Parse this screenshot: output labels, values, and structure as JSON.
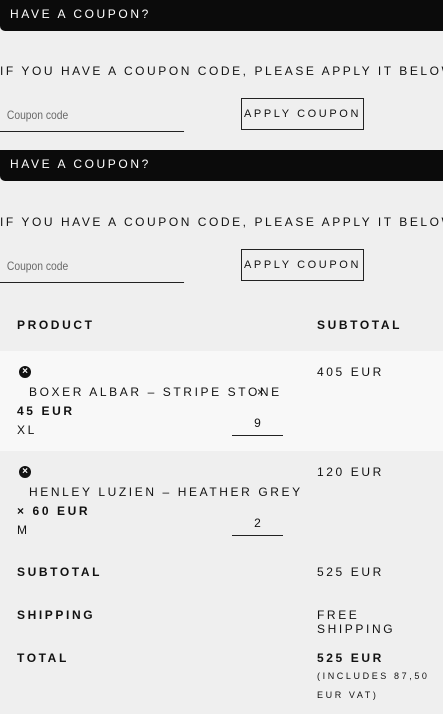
{
  "coupon_sections": [
    {
      "title": "HAVE A COUPON?",
      "info": "IF YOU HAVE A COUPON CODE, PLEASE APPLY IT BELOW.",
      "input_placeholder": "Coupon code",
      "button_label": "APPLY COUPON"
    },
    {
      "title": "HAVE A COUPON?",
      "info": "IF YOU HAVE A COUPON CODE, PLEASE APPLY IT BELOW.",
      "input_placeholder": "Coupon code",
      "button_label": "APPLY COUPON"
    }
  ],
  "table": {
    "headers": {
      "product": "PRODUCT",
      "subtotal": "SUBTOTAL"
    },
    "items": [
      {
        "remove_icon": "×",
        "name": "BOXER ALBAR – STRIPE STONE",
        "multiplier": "×",
        "price": "45 EUR",
        "variant": "XL",
        "quantity": "9",
        "subtotal": "405 EUR"
      },
      {
        "remove_icon": "×",
        "name": "HENLEY LUZIEN – HEATHER GREY",
        "multiplier": "×",
        "price": "60 EUR",
        "variant": "M",
        "quantity": "2",
        "subtotal": "120 EUR"
      }
    ]
  },
  "totals": {
    "subtotal_label": "SUBTOTAL",
    "subtotal_value": "525 EUR",
    "shipping_label": "SHIPPING",
    "shipping_value": "FREE SHIPPING",
    "total_label": "TOTAL",
    "total_value": "525 EUR",
    "vat_note": "(INCLUDES 87,50 EUR VAT)"
  },
  "colors": {
    "background": "#efefef",
    "bar": "#0b0b0b",
    "text": "#111111"
  }
}
